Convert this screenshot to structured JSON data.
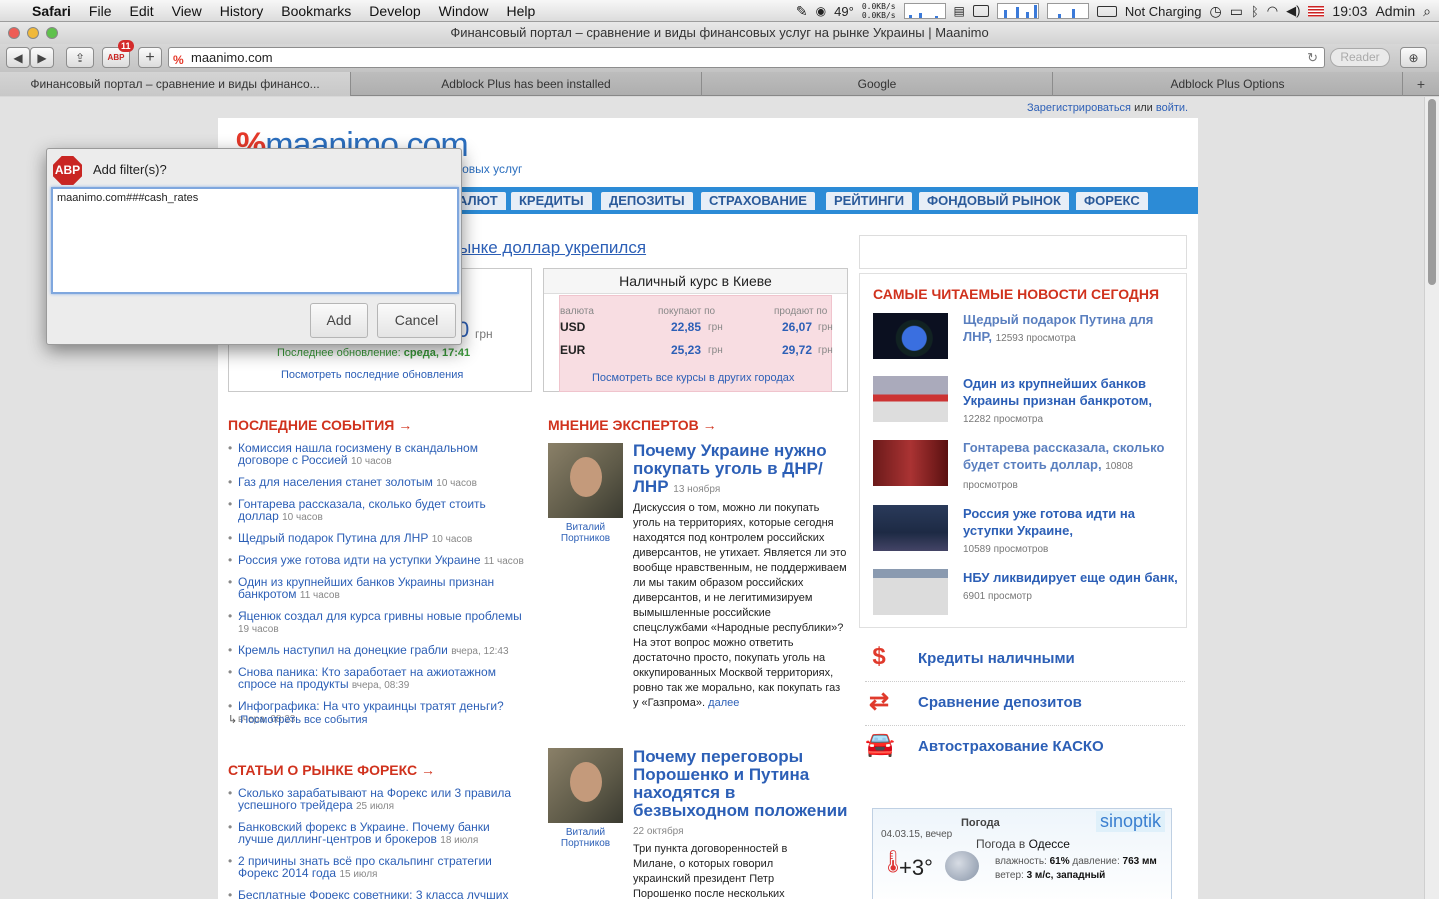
{
  "menubar": {
    "apple": "",
    "items": [
      "Safari",
      "File",
      "Edit",
      "View",
      "History",
      "Bookmarks",
      "Develop",
      "Window",
      "Help"
    ],
    "temperature": "49°",
    "net_up": "0.0KB/s",
    "net_down": "0.0KB/s",
    "battery": "Not Charging",
    "time": "19:03",
    "user": "Admin"
  },
  "window": {
    "title": "Финансовый портал – сравнение и виды финансовых услуг на рынке Украины | Maanimo"
  },
  "toolbar": {
    "address": "maanimo.com",
    "reader_label": "Reader",
    "adblock_badge": "11",
    "add_label": "+"
  },
  "tabs": [
    {
      "label": "Финансовый портал – сравнение и виды финансо..."
    },
    {
      "label": "Adblock Plus has been installed"
    },
    {
      "label": "Google"
    },
    {
      "label": "Adblock Plus Options"
    }
  ],
  "page": {
    "register": "Зарегистрироваться",
    "or": "или",
    "login": "войти.",
    "logo_text": "maanimo.com",
    "tagline": "совых услуг",
    "nav": [
      "АЛЮТ",
      "КРЕДИТЫ",
      "ДЕПОЗИТЫ",
      "СТРАХОВАНИЕ",
      "РЕЙТИНГИ",
      "ФОНДОВЫЙ РЫНОК",
      "ФОРЕКС"
    ],
    "headline": "ынке доллар укрепился",
    "left_box": {
      "value_tail": "0",
      "unit": "грн",
      "updated_label": "Последнее обновление:",
      "updated_value": "среда, 17:41",
      "link": "Посмотреть последние обновления"
    },
    "cash_box": {
      "title": "Наличный курс в Киеве",
      "col_currency": "валюта",
      "col_buy": "покупают по",
      "col_sell": "продают по",
      "rows": [
        {
          "cur": "USD",
          "buy": "22,85",
          "sell": "26,07"
        },
        {
          "cur": "EUR",
          "buy": "25,23",
          "sell": "29,72"
        }
      ],
      "unit": "грн",
      "link": "Посмотреть все курсы в других городах"
    },
    "events": {
      "title": "ПОСЛЕДНИЕ СОБЫТИЯ →",
      "items": [
        {
          "text": "Комиссия нашла госизмену в скандальном договоре с Россией",
          "time": "10 часов"
        },
        {
          "text": "Газ для населения станет золотым",
          "time": "10 часов"
        },
        {
          "text": "Гонтарева рассказала, сколько будет стоить доллар",
          "time": "10 часов"
        },
        {
          "text": "Щедрый подарок Путина для ЛНР",
          "time": "10 часов"
        },
        {
          "text": "Россия уже готова идти на уступки Украине",
          "time": "11 часов"
        },
        {
          "text": "Один из крупнейших банков Украины признан банкротом",
          "time": "11 часов"
        },
        {
          "text": "Яценюк создал для курса гривны новые проблемы",
          "time": "19 часов"
        },
        {
          "text": "Кремль наступил на донецкие грабли",
          "time": "вчера, 12:43"
        },
        {
          "text": "Снова паника: Кто заработает на ажиотажном спросе на продукты",
          "time": "вчера, 08:39"
        },
        {
          "text": "Инфографика: На что украинцы тратят деньги?",
          "time": "вчера, 08:23"
        }
      ],
      "all_link": "Посмотреть все события"
    },
    "forex": {
      "title": "СТАТЬИ О РЫНКЕ ФОРЕКС →",
      "items": [
        {
          "text": "Сколько зарабатывают на Форекс или 3 правила успешного трейдера",
          "time": "25 июля"
        },
        {
          "text": "Банковский форекс в Украине. Почему банки лучше диллинг-центров и брокеров",
          "time": "18 июля"
        },
        {
          "text": "2 причины знать всё про скальпинг стратегии Форекс 2014 года",
          "time": "15 июля"
        },
        {
          "text": "Бесплатные Форекс советники: 3 класса лучших",
          "time": ""
        }
      ]
    },
    "experts": {
      "title": "МНЕНИЕ ЭКСПЕРТОВ →",
      "items": [
        {
          "name": "Виталий Портников",
          "headline": "Почему Украине нужно покупать уголь в ДНР/ЛНР",
          "date": "13 ноября",
          "text": "Дискуссия о том, можно ли покупать уголь на территориях, которые сегодня находятся под контролем российских диверсантов, не утихает. Является ли это вообще нравственным, не поддерживаем ли мы таким образом российских диверсантов, и не легитимизируем вымышленные российские спецслужбами «Народные республики»? На этот вопрос можно ответить достаточно просто, покупать уголь на оккупированных Москвой территориях, ровно так же морально, как покупать газ у «Газпрома».",
          "more": "далее"
        },
        {
          "name": "Виталий Портников",
          "headline": "Почему переговоры Порошенко и Путина находятся в безвыходном положении",
          "date": "22 октября",
          "text": "Три пункта договоренностей в Милане, о которых говорил украинский президент Петр Порошенко после нескольких",
          "more": ""
        }
      ]
    },
    "top_news": {
      "title": "САМЫЕ ЧИТАЕМЫЕ НОВОСТИ СЕГОДНЯ",
      "items": [
        {
          "title": "Щедрый подарок Путина для ЛНР",
          "views": "12593 просмотра"
        },
        {
          "title": "Один из крупнейших банков Украины признан банкротом",
          "views": "12282 просмотра"
        },
        {
          "title": "Гонтарева рассказала, сколько будет стоить доллар",
          "views": "10808 просмотров"
        },
        {
          "title": "Россия уже готова идти на уступки Украине",
          "views": "10589 просмотров"
        },
        {
          "title": "НБУ ликвидирует еще один банк",
          "views": "6901 просмотр"
        }
      ]
    },
    "services": [
      {
        "label": "Кредиты наличными",
        "icon": "money-bag-icon"
      },
      {
        "label": "Сравнение депозитов",
        "icon": "arrows-icon"
      },
      {
        "label": "Автострахование КАСКО",
        "icon": "car-insurance-icon"
      }
    ],
    "weather": {
      "title": "Погода",
      "brand": "sinoptik",
      "date": "04.03.15, вечер",
      "city_prefix": "Погода в",
      "city": "Одессе",
      "temp": "+3°",
      "humidity_label": "влажность:",
      "humidity": "61%",
      "pressure_label": "давление:",
      "pressure": "763 мм",
      "wind_label": "ветер:",
      "wind": "3 м/с, западный"
    }
  },
  "dialog": {
    "title": "Add filter(s)?",
    "filter_value": "maanimo.com###cash_rates",
    "add_label": "Add",
    "cancel_label": "Cancel"
  },
  "colors": {
    "accent": "#2c8bd6",
    "link": "#2c5fb6",
    "section_red": "#d0321d",
    "abp_red": "#c92623"
  }
}
